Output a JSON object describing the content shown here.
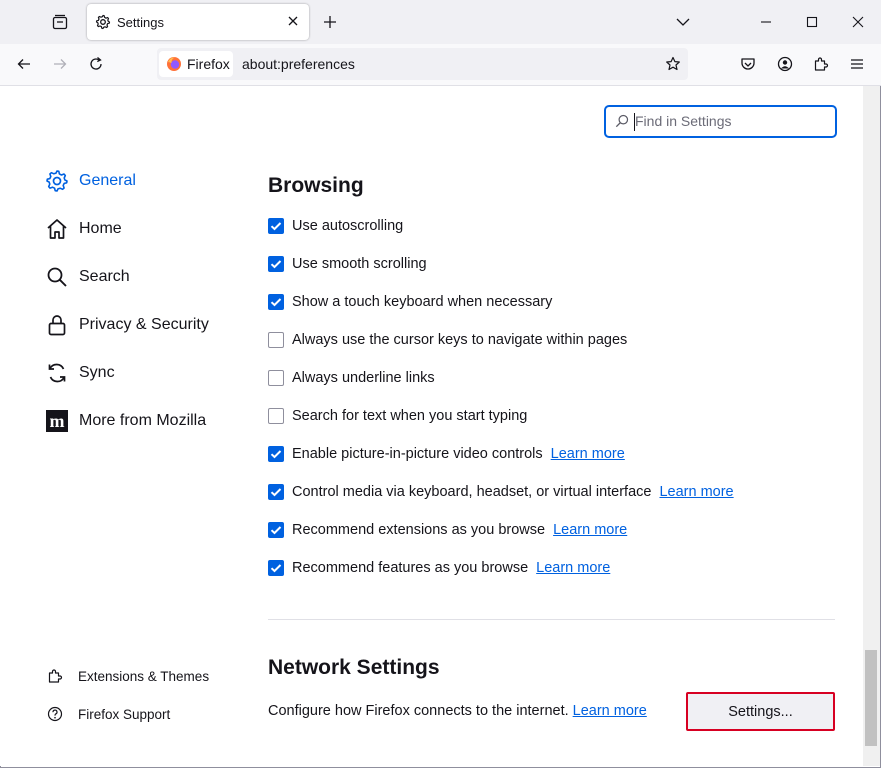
{
  "tab": {
    "title": "Settings"
  },
  "urlbar": {
    "identity_label": "Firefox",
    "url": "about:preferences"
  },
  "search": {
    "placeholder": "Find in Settings"
  },
  "sidebar": {
    "items": [
      {
        "label": "General",
        "icon": "gear-icon",
        "selected": true
      },
      {
        "label": "Home",
        "icon": "home-icon"
      },
      {
        "label": "Search",
        "icon": "search-icon"
      },
      {
        "label": "Privacy & Security",
        "icon": "lock-icon"
      },
      {
        "label": "Sync",
        "icon": "sync-icon"
      },
      {
        "label": "More from Mozilla",
        "icon": "mozilla-icon"
      }
    ],
    "footer": [
      {
        "label": "Extensions & Themes",
        "icon": "puzzle-icon"
      },
      {
        "label": "Firefox Support",
        "icon": "help-icon"
      }
    ]
  },
  "browsing": {
    "heading": "Browsing",
    "options": [
      {
        "label": "Use autoscrolling",
        "checked": true
      },
      {
        "label": "Use smooth scrolling",
        "checked": true
      },
      {
        "label": "Show a touch keyboard when necessary",
        "checked": true
      },
      {
        "label": "Always use the cursor keys to navigate within pages",
        "checked": false
      },
      {
        "label": "Always underline links",
        "checked": false
      },
      {
        "label": "Search for text when you start typing",
        "checked": false
      },
      {
        "label": "Enable picture-in-picture video controls",
        "checked": true,
        "link": "Learn more"
      },
      {
        "label": "Control media via keyboard, headset, or virtual interface",
        "checked": true,
        "link": "Learn more"
      },
      {
        "label": "Recommend extensions as you browse",
        "checked": true,
        "link": "Learn more"
      },
      {
        "label": "Recommend features as you browse",
        "checked": true,
        "link": "Learn more"
      }
    ]
  },
  "network": {
    "heading": "Network Settings",
    "description": "Configure how Firefox connects to the internet.",
    "link": "Learn more",
    "button": "Settings..."
  },
  "colors": {
    "accent": "#0061e0",
    "focus_outline": "#d70022"
  }
}
